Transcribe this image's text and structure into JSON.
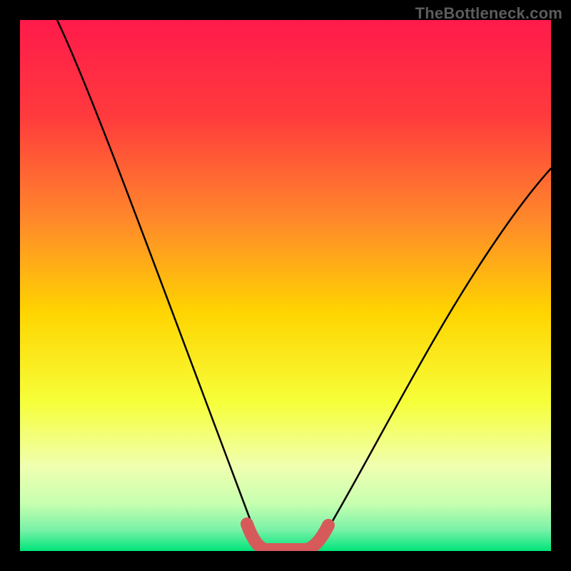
{
  "watermark": "TheBottleneck.com",
  "chart_data": {
    "type": "line",
    "title": "",
    "xlabel": "",
    "ylabel": "",
    "xlim": [
      0,
      100
    ],
    "ylim": [
      0,
      100
    ],
    "series": [
      {
        "name": "left-branch",
        "x": [
          7,
          10,
          14,
          18,
          22,
          26,
          30,
          34,
          37,
          40,
          42,
          44,
          45
        ],
        "y": [
          100,
          92,
          80,
          67,
          54,
          42,
          30,
          19,
          11,
          5,
          2,
          0.5,
          0
        ]
      },
      {
        "name": "flat-minimum",
        "x": [
          45,
          47.5,
          50,
          52.5,
          54
        ],
        "y": [
          0,
          0,
          0,
          0,
          0
        ]
      },
      {
        "name": "right-branch",
        "x": [
          54,
          56,
          59,
          63,
          67,
          72,
          77,
          82,
          87,
          92,
          97,
          100
        ],
        "y": [
          0,
          1,
          4,
          10,
          17,
          25,
          33,
          41,
          48,
          55,
          61,
          65
        ]
      }
    ],
    "overlay_segments": [
      {
        "name": "left-pink-end",
        "x": [
          42,
          44,
          45
        ],
        "y": [
          2,
          0.5,
          0
        ]
      },
      {
        "name": "pink-flat",
        "x": [
          45,
          47.5,
          50,
          52.5,
          54
        ],
        "y": [
          0,
          0,
          0,
          0,
          0
        ]
      },
      {
        "name": "right-pink-end",
        "x": [
          54,
          56,
          58
        ],
        "y": [
          0,
          1,
          3
        ]
      }
    ],
    "colors": {
      "gradient_top": "#ff1a4b",
      "gradient_mid1": "#ff7a2a",
      "gradient_mid2": "#ffd400",
      "gradient_mid3": "#f6ff66",
      "gradient_mid4": "#d6ff8a",
      "gradient_bottom": "#00e57a",
      "curve": "#000000",
      "overlay": "#d65a5a"
    }
  }
}
